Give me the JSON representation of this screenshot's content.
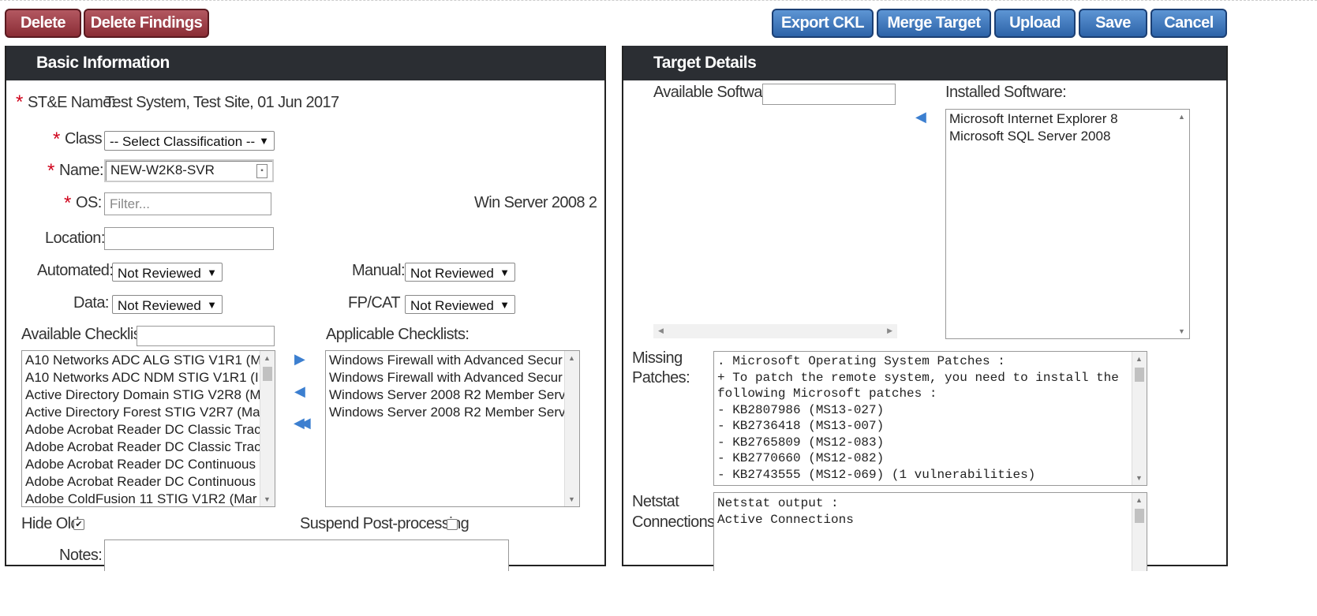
{
  "toolbar": {
    "delete": "Delete",
    "delete_findings": "Delete Findings",
    "export_ckl": "Export CKL",
    "merge_target": "Merge Target",
    "upload": "Upload",
    "save": "Save",
    "cancel": "Cancel"
  },
  "basic": {
    "title": "Basic Information",
    "ste_name_label": "ST&E Name:",
    "ste_name_value": "Test System, Test Site, 01 Jun 2017",
    "class_label": "Class",
    "class_value": "-- Select Classification --",
    "name_label": "Name:",
    "name_value": "NEW-W2K8-SVR",
    "os_label": "OS:",
    "os_placeholder": "Filter...",
    "os_value": "Win Server 2008 2",
    "location_label": "Location:",
    "location_value": "",
    "automated_label": "Automated:",
    "automated_value": "Not Reviewed",
    "manual_label": "Manual:",
    "manual_value": "Not Reviewed",
    "data_label": "Data:",
    "data_value": "Not Reviewed",
    "fpcat_label": "FP/CAT I:",
    "fpcat_value": "Not Reviewed",
    "available_checklists_label": "Available Checklists:",
    "available_checklists": [
      "A10 Networks ADC ALG STIG V1R1 (M",
      "A10 Networks ADC NDM STIG V1R1 (I",
      "Active Directory Domain STIG V2R8 (M",
      "Active Directory Forest STIG V2R7 (Ma",
      "Adobe Acrobat Reader DC Classic Trac",
      "Adobe Acrobat Reader DC Classic Trac",
      "Adobe Acrobat Reader DC Continuous",
      "Adobe Acrobat Reader DC Continuous",
      "Adobe ColdFusion 11 STIG V1R2 (Mar"
    ],
    "applicable_checklists_label": "Applicable Checklists:",
    "applicable_checklists": [
      "Windows Firewall with Advanced Secur",
      "Windows Firewall with Advanced Secur",
      "Windows Server 2008 R2 Member Serv",
      "Windows Server 2008 R2 Member Serv"
    ],
    "hide_old_label": "Hide Old",
    "hide_old_checked": true,
    "suspend_label": "Suspend Post-processing",
    "suspend_checked": false,
    "notes_label": "Notes:"
  },
  "target": {
    "title": "Target Details",
    "available_software_label": "Available Software:",
    "installed_software_label": "Installed Software:",
    "installed_software": [
      "Microsoft Internet Explorer 8",
      "Microsoft SQL Server 2008"
    ],
    "missing_patches_label_1": "Missing",
    "missing_patches_label_2": "Patches:",
    "missing_patches": [
      ". Microsoft Operating System Patches :",
      "+ To patch the remote system, you need to install the",
      "following Microsoft patches :",
      "- KB2807986 (MS13-027)",
      "- KB2736418 (MS13-007)",
      "- KB2765809 (MS12-083)",
      "- KB2770660 (MS12-082)",
      "- KB2743555 (MS12-069) (1 vulnerabilities)"
    ],
    "netstat_label_1": "Netstat",
    "netstat_label_2": "Connections:",
    "netstat": [
      "Netstat output :",
      "",
      "Active Connections"
    ]
  },
  "colors": {
    "red_button": "#9a3a43",
    "blue_button": "#3b72b8",
    "panel_header": "#2b2e33",
    "required": "#d0021b"
  }
}
